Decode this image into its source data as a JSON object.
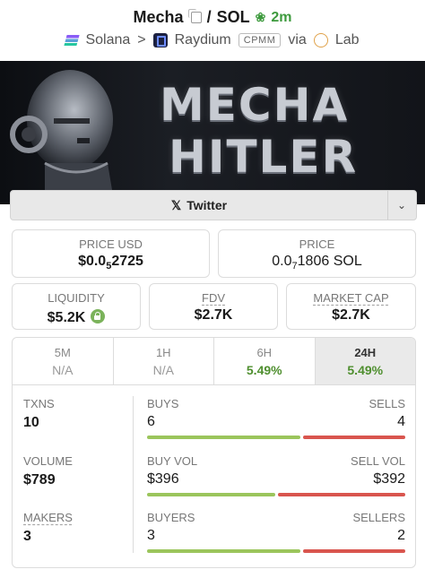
{
  "header": {
    "token": "Mecha",
    "slash": "/",
    "quote": "SOL",
    "age": "2m",
    "chain": "Solana",
    "sep": ">",
    "dex": "Raydium",
    "pool_type": "CPMM",
    "via": "via",
    "launchpad": "Lab"
  },
  "banner": {
    "line1": "MECHA",
    "line2": "HITLER"
  },
  "social": {
    "twitter_label": "Twitter",
    "twitter_icon": "x-logo-icon",
    "more_icon": "chevron-down-icon"
  },
  "price": {
    "usd_label": "PRICE USD",
    "usd_prefix": "$0.0",
    "usd_sub": "5",
    "usd_rest": "2725",
    "native_label": "PRICE",
    "native_prefix": "0.0",
    "native_sub": "7",
    "native_rest": "1806 SOL"
  },
  "metrics": {
    "liquidity_label": "LIQUIDITY",
    "liquidity_value": "$5.2K",
    "fdv_label": "FDV",
    "fdv_value": "$2.7K",
    "mcap_label": "MARKET CAP",
    "mcap_value": "$2.7K"
  },
  "tabs": [
    {
      "label": "5M",
      "value": "N/A"
    },
    {
      "label": "1H",
      "value": "N/A"
    },
    {
      "label": "6H",
      "value": "5.49%"
    },
    {
      "label": "24H",
      "value": "5.49%"
    }
  ],
  "stats": {
    "txns_label": "TXNS",
    "txns_value": "10",
    "volume_label": "VOLUME",
    "volume_value": "$789",
    "makers_label": "MAKERS",
    "makers_value": "3",
    "buys_label": "BUYS",
    "sells_label": "SELLS",
    "buys": "6",
    "sells": "4",
    "buys_ratio": 0.6,
    "buyvol_label": "BUY VOL",
    "sellvol_label": "SELL VOL",
    "buyvol": "$396",
    "sellvol": "$392",
    "buyvol_ratio": 0.503,
    "buyers_label": "BUYERS",
    "sellers_label": "SELLERS",
    "buyers": "3",
    "sellers": "2",
    "buyers_ratio": 0.6
  },
  "colors": {
    "positive": "#4f8f2f",
    "buy_bar": "#9bc55c",
    "sell_bar": "#d9554e"
  }
}
